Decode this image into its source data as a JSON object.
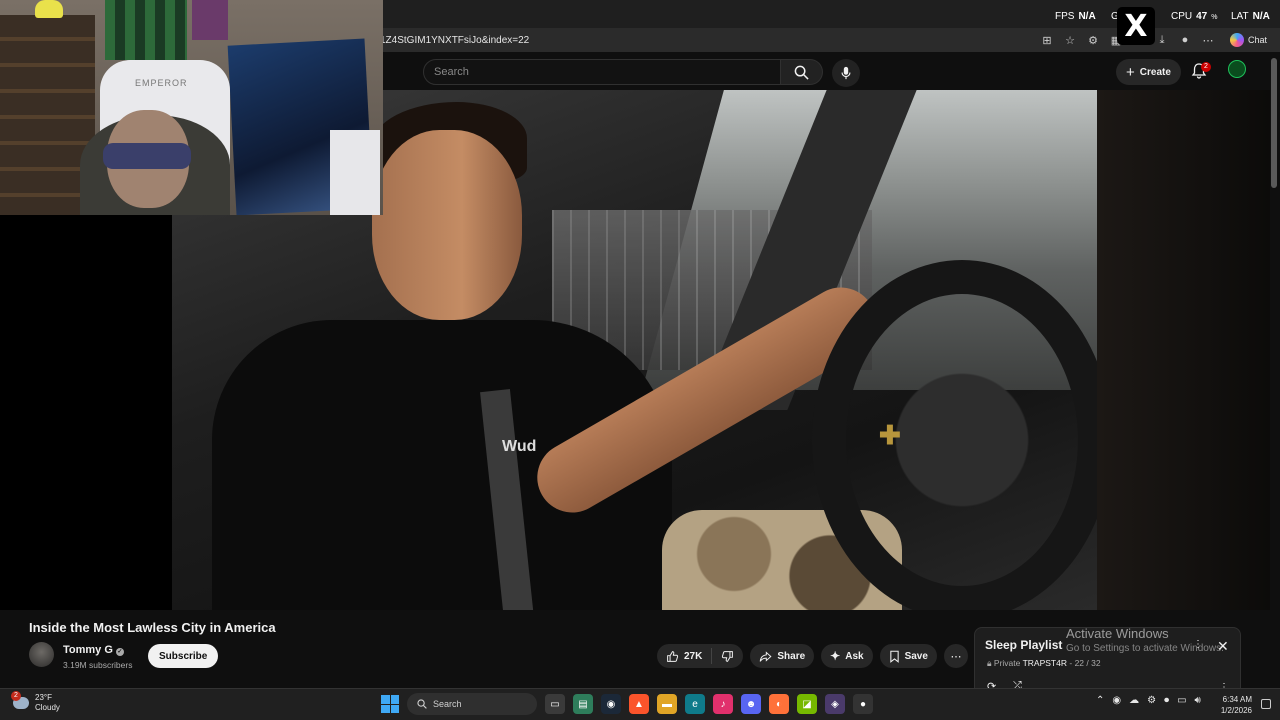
{
  "browser": {
    "url_text": "1Z4StGIM1YNXTFsiJo&index=22",
    "chat_label": "Chat"
  },
  "perf_overlay": {
    "fps_label": "FPS",
    "fps_value": "N/A",
    "gpu_label": "G",
    "cpu_label": "CPU",
    "cpu_value": "47",
    "cpu_unit": "%",
    "lat_label": "LAT",
    "lat_value": "N/A"
  },
  "youtube_header": {
    "search_placeholder": "Search",
    "create_label": "Create",
    "notification_count": "2"
  },
  "webcam": {
    "chair_brand": "EMPEROR"
  },
  "video": {
    "title": "Inside the Most Lawless City in America",
    "shirt_text": "Wud",
    "wheel_emblem": "✚"
  },
  "channel": {
    "name": "Tommy G",
    "subscribers": "3.19M subscribers",
    "subscribe_label": "Subscribe"
  },
  "actions": {
    "like_count": "27K",
    "share_label": "Share",
    "ask_label": "Ask",
    "save_label": "Save"
  },
  "playlist": {
    "title": "Sleep Playlist",
    "privacy": "Private",
    "owner": "TRAPST4R",
    "position": "- 22 / 32"
  },
  "activation": {
    "title": "Activate Windows",
    "subtitle": "Go to Settings to activate Windows."
  },
  "taskbar": {
    "weather_badge": "2",
    "temperature": "23°F",
    "condition": "Cloudy",
    "search_label": "Search",
    "time": "6:34 AM",
    "date": "1/2/2026"
  },
  "colors": {
    "background": "#0f0f0f",
    "pill": "#272727",
    "accent_red": "#cc0000"
  }
}
